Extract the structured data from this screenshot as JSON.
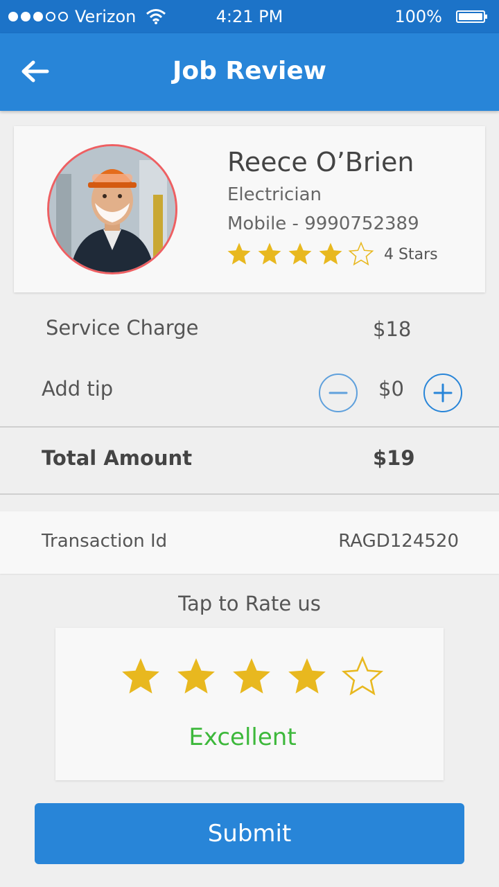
{
  "status_bar": {
    "carrier": "Verizon",
    "time": "4:21 PM",
    "battery": "100%"
  },
  "header": {
    "title": "Job Review",
    "back_icon": "back-arrow-icon"
  },
  "worker": {
    "name": "Reece O’Brien",
    "role": "Electrician",
    "mobile": "Mobile - 9990752389",
    "rating": 4,
    "rating_max": 5,
    "rating_label": "4 Stars"
  },
  "charges": {
    "service_label": "Service Charge",
    "service_value": "$18",
    "tip_label": "Add tip",
    "tip_value": "$0",
    "total_label": "Total Amount",
    "total_value": "$19"
  },
  "transaction": {
    "label": "Transaction Id",
    "value": "RAGD124520"
  },
  "rating_section": {
    "title": "Tap to Rate us",
    "selected": 4,
    "max": 5,
    "label": "Excellent"
  },
  "submit_label": "Submit",
  "colors": {
    "primary": "#2885d8",
    "status_bar": "#1c73c8",
    "star": "#e8b81f",
    "excellent": "#3db83b",
    "avatar_border": "#ee5f62"
  }
}
